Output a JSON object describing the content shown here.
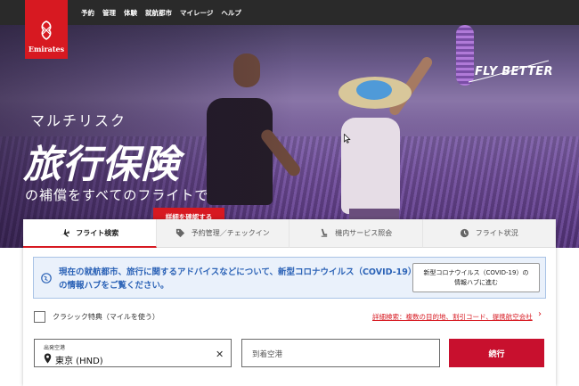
{
  "nav": {
    "items": [
      "予約",
      "管理",
      "体験",
      "就航都市",
      "マイレージ",
      "ヘルプ"
    ]
  },
  "brand": {
    "logo_text": "Emirates",
    "tagline": "FLY BETTER",
    "color": "#d71921"
  },
  "hero": {
    "line1": "マルチリスク",
    "title": "旅行保険",
    "line2": "の補償をすべてのフライトで",
    "button": "詳細を確認する"
  },
  "tabs": [
    {
      "label": "フライト検索",
      "icon": "airplane-icon",
      "active": true
    },
    {
      "label": "予約管理／チェックイン",
      "icon": "tag-icon",
      "active": false
    },
    {
      "label": "機内サービス照会",
      "icon": "seat-icon",
      "active": false
    },
    {
      "label": "フライト状況",
      "icon": "clock-icon",
      "active": false
    }
  ],
  "notice": {
    "text": "現在の就航都市、旅行に関するアドバイスなどについて、新型コロナウイルス（COVID-19）の情報ハブをご覧ください。",
    "button_line1": "新型コロナウイルス（COVID-19）の",
    "button_line2": "情報ハブに進む"
  },
  "search": {
    "classic_label": "クラシック特典（マイルを使う）",
    "advanced_link": "詳細検索：複数の目的地、割引コード、提携航空会社",
    "from_label": "出発空港",
    "from_value": "東京 (HND)",
    "to_placeholder": "到着空港",
    "continue_label": "続行"
  }
}
